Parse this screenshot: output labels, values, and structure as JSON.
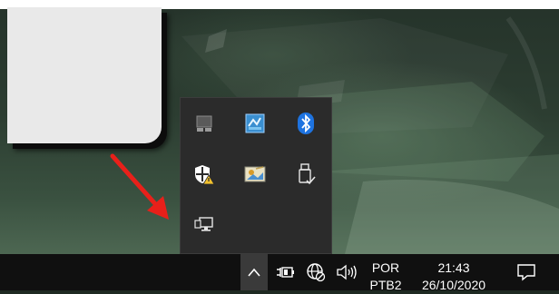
{
  "taskbar": {
    "language": {
      "line1": "POR",
      "line2": "PTB2"
    },
    "clock": {
      "time": "21:43",
      "date": "26/10/2020"
    },
    "tray": [
      {
        "icon": "show-hidden-icons-chevron-icon"
      },
      {
        "icon": "power-battery-icon"
      },
      {
        "icon": "network-globe-icon"
      },
      {
        "icon": "volume-speaker-icon"
      }
    ],
    "notifications_icon": "action-center-icon"
  },
  "overflow_panel": {
    "icons": [
      "drive-tray-icon",
      "blue-app-tray-icon",
      "bluetooth-icon",
      "windows-security-warning-icon",
      "app-tray-icon",
      "usb-safely-remove-icon",
      "network-monitor-icon"
    ]
  },
  "colors": {
    "taskbar_bg": "#101010",
    "panel_bg": "#2b2b2b",
    "annotation_arrow": "#e8201a",
    "bluetooth_blue": "#1e73e0"
  }
}
